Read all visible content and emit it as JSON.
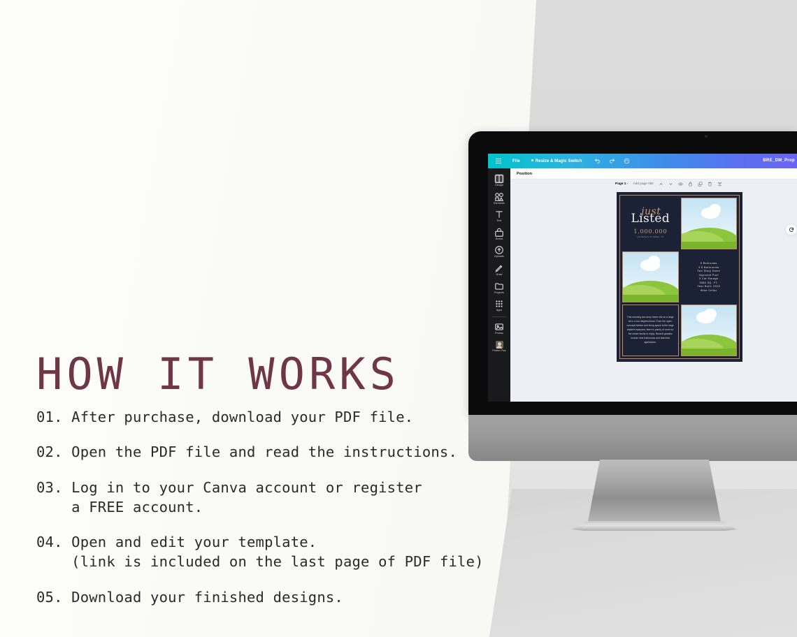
{
  "headline": "HOW IT WORKS",
  "steps": [
    "01. After purchase, download your PDF file.",
    "02. Open the PDF file and read the instructions.",
    "03. Log in to your Canva account or register\n    a FREE account.",
    "04. Open and edit your template.\n    (link is included on the last page of PDF file)",
    "05. Download your finished designs."
  ],
  "colors": {
    "headline": "#6e3647",
    "body": "#2a2a2a",
    "topbar_start": "#00c4cc",
    "topbar_end": "#6a64f2",
    "flyer_bg": "#1c2236",
    "flyer_accent": "#c99a72"
  },
  "app": {
    "topbar": {
      "menu_icon": "hamburger-icon",
      "file_label": "File",
      "resize_label": "Resize & Magic Switch",
      "undo_icon": "undo-icon",
      "redo_icon": "redo-icon",
      "sync_icon": "cloud-sync-icon",
      "document_title": "BRE_DM_Prop"
    },
    "sidebar": [
      {
        "label": "Design",
        "icon": "design-icon",
        "active": true
      },
      {
        "label": "Elements",
        "icon": "elements-icon",
        "active": false
      },
      {
        "label": "Text",
        "icon": "text-icon",
        "active": false
      },
      {
        "label": "Brand",
        "icon": "brand-icon",
        "active": false
      },
      {
        "label": "Uploads",
        "icon": "uploads-icon",
        "active": false
      },
      {
        "label": "Draw",
        "icon": "draw-icon",
        "active": false
      },
      {
        "label": "Projects",
        "icon": "projects-icon",
        "active": false
      },
      {
        "label": "Apps",
        "icon": "apps-icon",
        "active": false
      },
      {
        "label": "Photos",
        "icon": "photos-icon",
        "active": false
      },
      {
        "label": "Profile Pics",
        "icon": "avatar-icon",
        "active": false
      }
    ],
    "panel": {
      "tab_label": "Position"
    },
    "pagebar": {
      "page_label": "Page 1 -",
      "title_placeholder": "Add page title",
      "icons": [
        "chevron-up-icon",
        "chevron-down-icon",
        "eye-icon",
        "lock-icon",
        "duplicate-icon",
        "trash-icon",
        "expand-icon"
      ]
    },
    "refresh_icon": "refresh-icon"
  },
  "flyer": {
    "script_word": "just",
    "main_word": "Listed",
    "price": "1.000.000",
    "address": "123 Beverly St, Dallas, TX",
    "details": [
      "5  Bedrooms",
      "3.5 Bathrooms",
      "Two Story Home",
      "Inground Pool",
      "3 Car Garage",
      "3360 SQ. FT.",
      "Year Built: 2019",
      "Wine Cellar"
    ],
    "description": "This stunning two-story home sits on a large lot in a hot neighborhood. From the open-concept kitchen and living space to the large shaded backyard, there is plenty of room for the whole family to enjoy. Recent updates include new bathrooms and stainless appliances."
  }
}
